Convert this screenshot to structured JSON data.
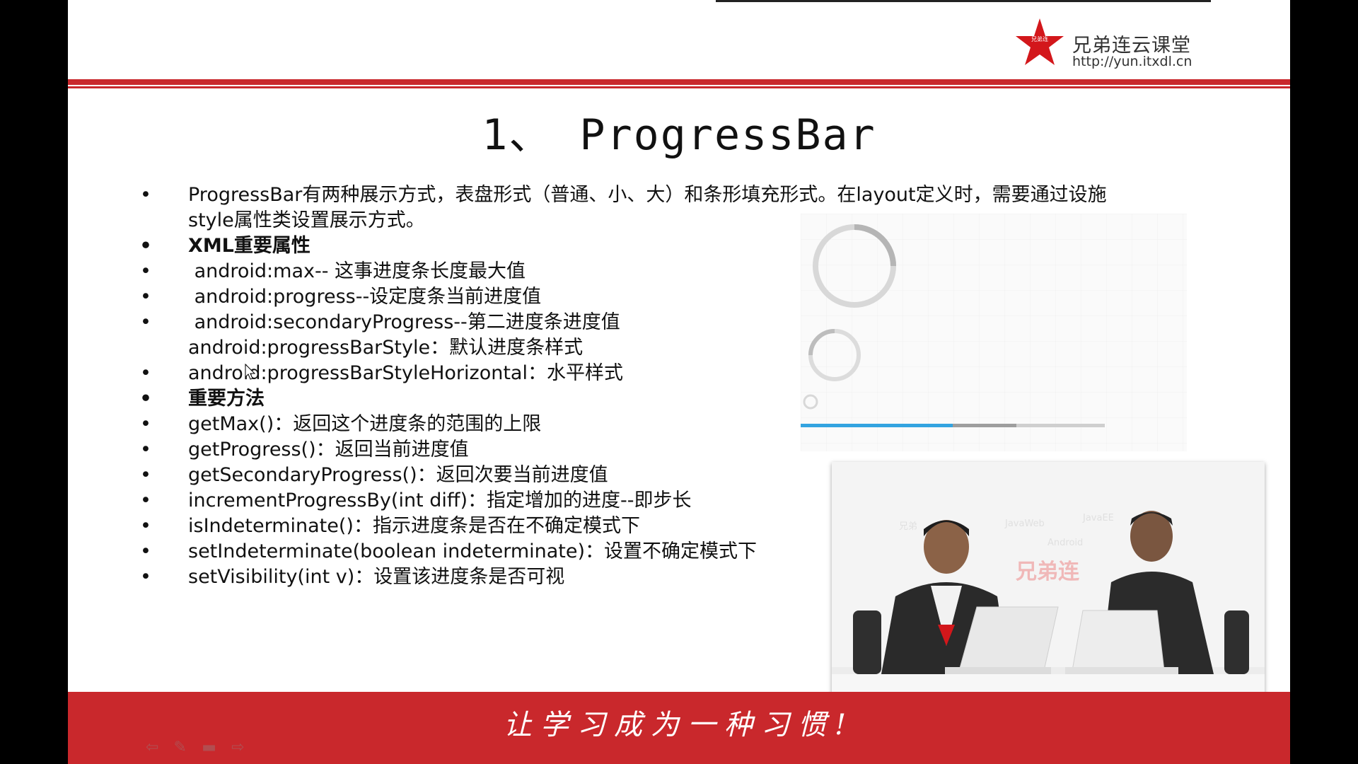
{
  "logo": {
    "name": "兄弟连云课堂",
    "url": "http://yun.itxdl.cn",
    "star_text": "兄弟连"
  },
  "title": "1、 ProgressBar",
  "bullets": [
    {
      "bullet": "•",
      "text": "ProgressBar有两种展示方式，表盘形式（普通、小、大）和条形填充形式。在layout定义时，需要通过设施",
      "bold": false
    },
    {
      "bullet": "",
      "text": "style属性类设置展示方式。",
      "bold": false
    },
    {
      "bullet": "•",
      "text": "XML重要属性",
      "bold": true
    },
    {
      "bullet": "•",
      "text": " android:max-- 这事进度条长度最大值",
      "bold": false
    },
    {
      "bullet": "•",
      "text": " android:progress--设定度条当前进度值",
      "bold": false
    },
    {
      "bullet": "•",
      "text": " android:secondaryProgress--第二进度条进度值",
      "bold": false
    },
    {
      "bullet": "",
      "text": "android:progressBarStyle：默认进度条样式",
      "bold": false
    },
    {
      "bullet": "•",
      "text": "android:progressBarStyleHorizontal：水平样式",
      "bold": false
    },
    {
      "bullet": "•",
      "text": "重要方法",
      "bold": true
    },
    {
      "bullet": "•",
      "text": "getMax()：返回这个进度条的范围的上限",
      "bold": false
    },
    {
      "bullet": "•",
      "text": "getProgress()：返回当前进度值",
      "bold": false
    },
    {
      "bullet": "•",
      "text": "getSecondaryProgress()：返回次要当前进度值",
      "bold": false
    },
    {
      "bullet": "•",
      "text": "incrementProgressBy(int diff)：指定增加的进度--即步长",
      "bold": false
    },
    {
      "bullet": "•",
      "text": "isIndeterminate()：指示进度条是否在不确定模式下",
      "bold": false
    },
    {
      "bullet": "•",
      "text": "setIndeterminate(boolean indeterminate)：设置不确定模式下",
      "bold": false
    },
    {
      "bullet": "•",
      "text": "setVisibility(int v)：设置该进度条是否可视",
      "bold": false
    }
  ],
  "demo": {
    "progress": 0.5,
    "secondary_progress": 0.71
  },
  "pip": {
    "brand": "兄弟连",
    "watermarks": [
      "JavaWeb",
      "JavaEE",
      "Android",
      "兄弟"
    ]
  },
  "slogan": "让学习成为一种习惯!",
  "colors": {
    "brand_red": "#c9282c",
    "progress_blue": "#33a4e0",
    "secondary_gray": "#9e9e9e"
  },
  "nav_icons": [
    "back-arrow-icon",
    "pen-icon",
    "slides-icon",
    "forward-arrow-icon"
  ]
}
